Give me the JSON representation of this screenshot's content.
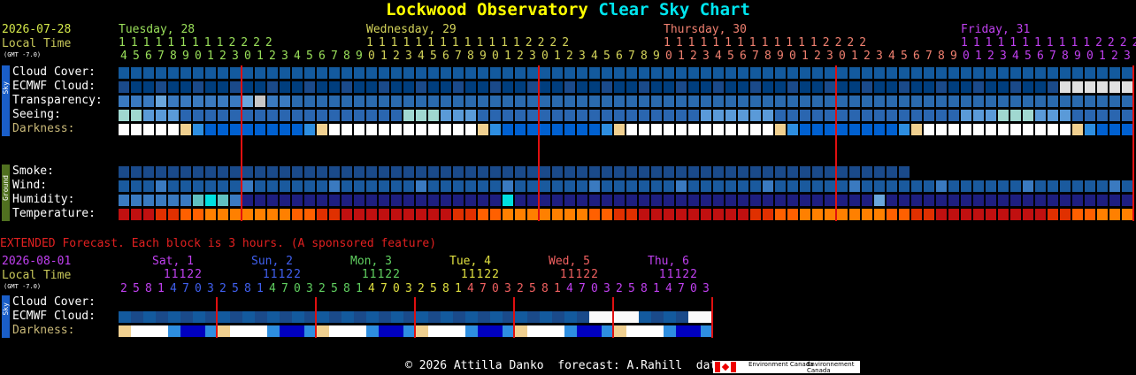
{
  "title": {
    "part1": "Lockwood Observatory",
    "part2": "Clear Sky Chart"
  },
  "main": {
    "date": "2026-07-28",
    "local_time": "Local Time",
    "gmt": "(GMT -7.0)",
    "days": [
      {
        "label": "Tuesday, 28",
        "color": "#9ae05a"
      },
      {
        "label": "Wednesday, 29",
        "color": "#d4d45a"
      },
      {
        "label": "Thursday, 30",
        "color": "#f08070"
      },
      {
        "label": "Friday, 31",
        "color": "#c040f0"
      }
    ],
    "hour_tens": [
      "                11111111112222",
      "1111111111112222",
      "11111111111112222",
      "11111111111112222"
    ],
    "hour_ones": "4567890123012345678901234567890123012345678901234567890123012345678901234567890123",
    "rows_sky": [
      "Cloud Cover:",
      "ECMWF Cloud:",
      "Transparency:",
      "Seeing:",
      "Darkness:"
    ],
    "rows_ground": [
      "Smoke:",
      "Wind:",
      "Humidity:",
      "Temperature:"
    ],
    "sky_tab": "Sky",
    "ground_tab": "Ground"
  },
  "extended": {
    "heading": "EXTENDED Forecast. Each block is 3 hours. (A sponsored feature)",
    "date": "2026-08-01",
    "local_time": "Local Time",
    "gmt": "(GMT -7.0)",
    "days": [
      {
        "label": "Sat, 1",
        "color": "#c040f0"
      },
      {
        "label": "Sun, 2",
        "color": "#4060f0"
      },
      {
        "label": "Mon, 3",
        "color": "#60d060"
      },
      {
        "label": "Tue, 4",
        "color": "#e0e040"
      },
      {
        "label": "Wed, 5",
        "color": "#f06060"
      },
      {
        "label": "Thu, 6",
        "color": "#c040f0"
      }
    ],
    "hour_tens": " 11122",
    "hour_ones": "258147032581470325814703258147032581470325814703",
    "rows": [
      "Cloud Cover:",
      "ECMWF Cloud:",
      "Darkness:"
    ],
    "sky_tab": "Sky"
  },
  "footer": {
    "text": "© 2026 Attilla Danko  forecast: A.Rahill  data:",
    "logo_en": "Environment Canada",
    "logo_fr": "Environnement Canada"
  },
  "colors": {
    "cloud_clear": "#003e7e",
    "cloud_light": "#135a9e",
    "cloud_overcast": "#fafafa",
    "ecmwf_overcast": "#e0e0e0",
    "transparency_good": "#2a6aae",
    "transparency_poor": "#c8c8c8",
    "seeing_good": "#5a9ad8",
    "seeing_excellent": "#a0d8d0",
    "darkness_day": "#ffffff",
    "darkness_night": "#0000c0",
    "midnight_line": "#e01010",
    "heading_red": "#e02020"
  }
}
